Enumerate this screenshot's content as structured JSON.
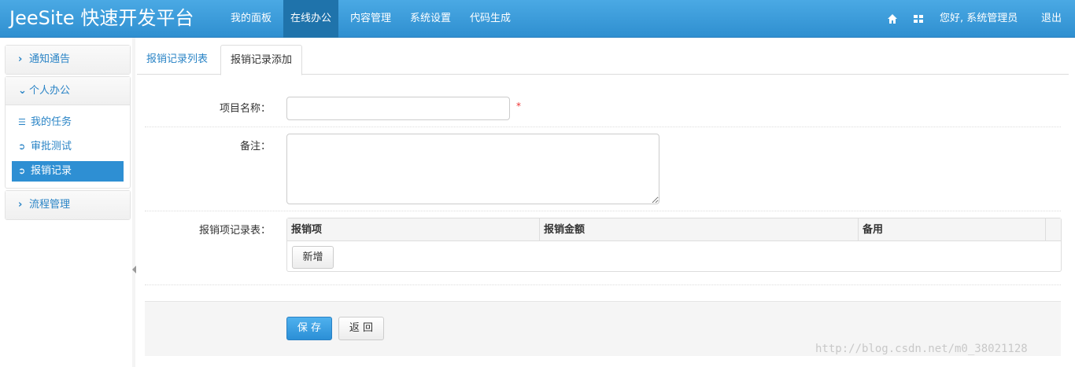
{
  "navbar": {
    "brand": "JeeSite 快速开发平台",
    "items": [
      "我的面板",
      "在线办公",
      "内容管理",
      "系统设置",
      "代码生成"
    ],
    "active_index": 1,
    "home_icon": "home-icon",
    "apps_icon": "grid-icon",
    "greeting": "您好, 系统管理员",
    "logout": "退出"
  },
  "sidebar": {
    "groups": [
      {
        "label": "通知通告",
        "expanded": false
      },
      {
        "label": "个人办公",
        "expanded": true,
        "items": [
          {
            "label": "我的任务",
            "icon": "list-icon"
          },
          {
            "label": "审批测试",
            "icon": "circle-arrow-icon"
          },
          {
            "label": "报销记录",
            "icon": "circle-arrow-icon",
            "active": true
          }
        ]
      },
      {
        "label": "流程管理",
        "expanded": false
      }
    ]
  },
  "tabs": [
    "报销记录列表",
    "报销记录添加"
  ],
  "form": {
    "project_label": "项目名称：",
    "project_value": "",
    "required_mark": "*",
    "remark_label": "备注：",
    "remark_value": "",
    "items_label": "报销项记录表：",
    "table_headers": [
      "报销项",
      "报销金额",
      "备用"
    ],
    "add_button": "新增",
    "save_button": "保 存",
    "back_button": "返 回"
  },
  "watermark": "http://blog.csdn.net/m0_38021128",
  "colors": {
    "navbar": "#3a9ddb",
    "accent": "#2a84c6",
    "active_nav": "#1f73ab"
  }
}
